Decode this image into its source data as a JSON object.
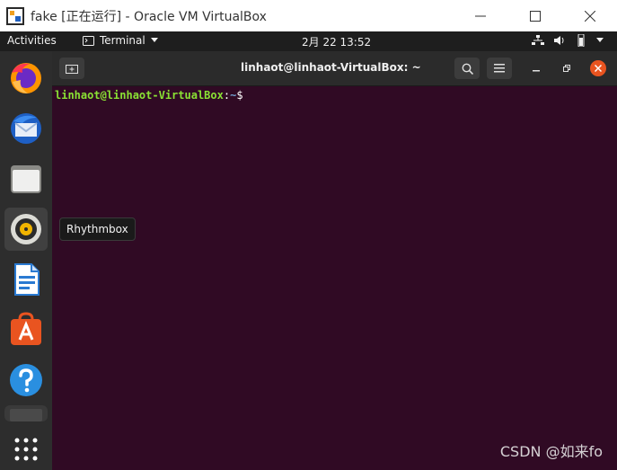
{
  "host_window": {
    "title": "fake [正在运行] - Oracle VM VirtualBox",
    "icon": "virtualbox-icon",
    "controls": [
      "minimize-icon",
      "maximize-icon",
      "close-icon"
    ]
  },
  "topbar": {
    "activities": "Activities",
    "app_menu": "Terminal",
    "clock": "2月 22  13:52",
    "tray_icons": [
      "network-icon",
      "volume-icon",
      "battery-icon",
      "chevron-down-icon"
    ]
  },
  "dock": {
    "items": [
      {
        "name": "firefox-icon"
      },
      {
        "name": "thunderbird-icon"
      },
      {
        "name": "files-icon"
      },
      {
        "name": "rhythmbox-icon"
      },
      {
        "name": "libreoffice-writer-icon"
      },
      {
        "name": "software-icon"
      },
      {
        "name": "help-icon"
      },
      {
        "name": "terminal-icon"
      }
    ],
    "show_apps": "app-grid-icon"
  },
  "tooltip": {
    "text": "Rhythmbox"
  },
  "terminal": {
    "title": "linhaot@linhaot-VirtualBox: ~",
    "prompt_user": "linhaot@linhaot-VirtualBox",
    "prompt_colon": ":",
    "prompt_path": "~",
    "prompt_symbol": "$"
  },
  "watermark": "CSDN @如来fo",
  "colors": {
    "terminal_bg": "#300a24",
    "accent": "#e95420",
    "prompt_user": "#8ae234",
    "prompt_path": "#729fcf"
  }
}
